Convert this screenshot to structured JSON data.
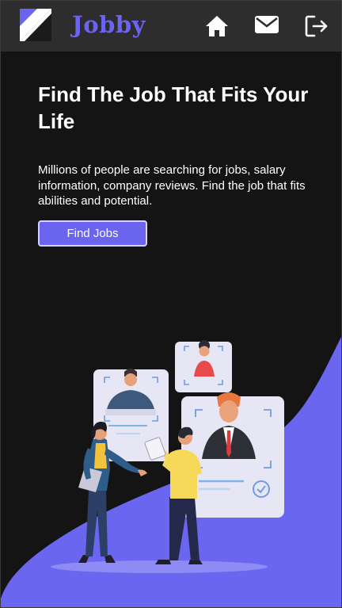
{
  "navbar": {
    "brand": "Jobby",
    "icons": [
      "logo-icon",
      "home-icon",
      "mail-icon",
      "logout-icon"
    ]
  },
  "hero": {
    "title": "Find The Job That Fits Your Life",
    "description": "Millions of people are searching for jobs, salary information, company reviews. Find the job that fits abilities and potential.",
    "cta_label": "Find Jobs"
  },
  "colors": {
    "accent": "#6c63f0",
    "navbar_bg": "#2d2d2d",
    "page_bg": "#141414",
    "wave": "#6b66f0"
  }
}
